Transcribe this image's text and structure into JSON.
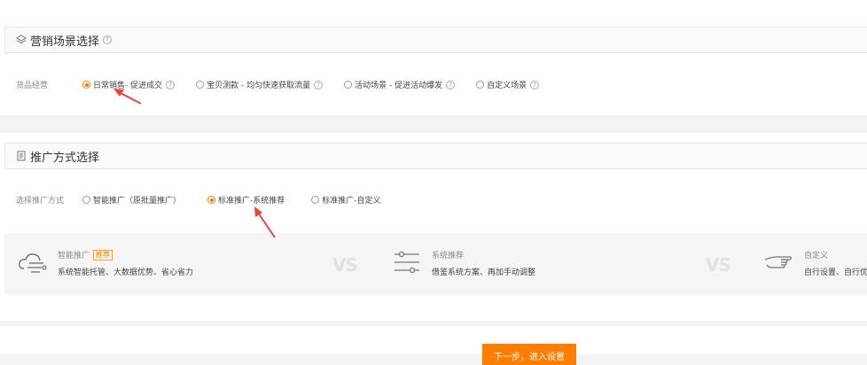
{
  "scene": {
    "title": "营销场景选择",
    "row_label": "货品经营",
    "options": [
      {
        "label": "日常销售- 促进成交",
        "checked": true,
        "help": true
      },
      {
        "label": "宝贝测款 - 均匀快速获取流量",
        "checked": false,
        "help": true
      },
      {
        "label": "活动场景 - 促进活动爆发",
        "checked": false,
        "help": true
      },
      {
        "label": "自定义场景",
        "checked": false,
        "help": true
      }
    ]
  },
  "promo": {
    "title": "推广方式选择",
    "row_label": "选择推广方式",
    "options": [
      {
        "label": "智能推广（原批量推广）",
        "checked": false
      },
      {
        "label": "标准推广-系统推荐",
        "checked": true
      },
      {
        "label": "标准推广-自定义",
        "checked": false
      }
    ]
  },
  "compare": {
    "vs_label": "VS",
    "items": [
      {
        "title": "智能推广",
        "badge": "推荐",
        "desc": "系统智能托管、大数据优势、省心省力",
        "icon": "cloud-gear-icon"
      },
      {
        "title": "系统推荐",
        "badge": "",
        "desc": "借鉴系统方案、再加手动调整",
        "icon": "sliders-icon"
      },
      {
        "title": "自定义",
        "badge": "",
        "desc": "自行设置、自行优化",
        "icon": "hand-pointer-icon"
      }
    ]
  },
  "footer": {
    "next_label": "下一步，进入设置"
  },
  "colors": {
    "accent": "#ff7d00",
    "arrow": "#e8453c"
  }
}
